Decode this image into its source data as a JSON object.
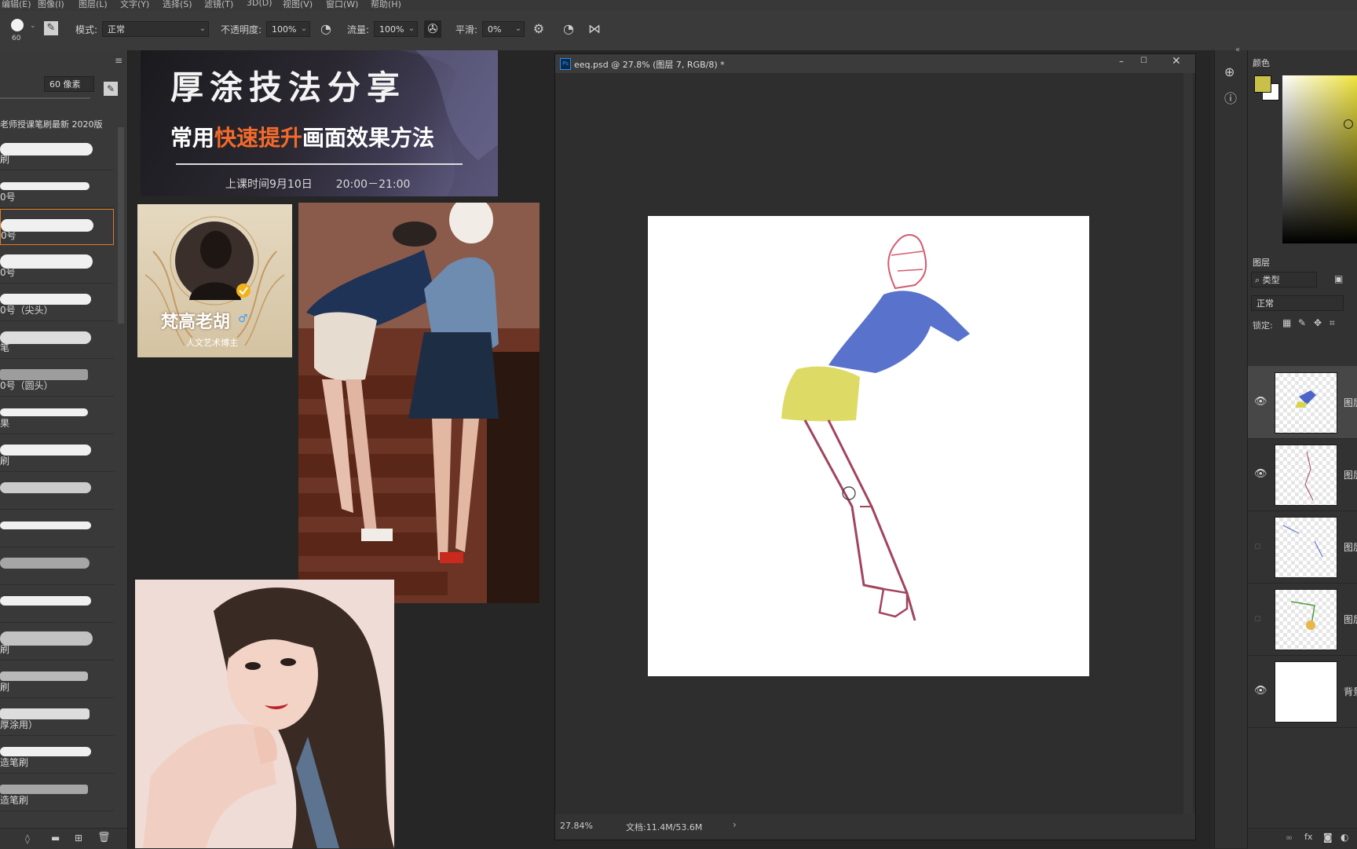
{
  "menubar": {
    "items": [
      "编辑(E)",
      "图像(I)",
      "图层(L)",
      "文字(Y)",
      "选择(S)",
      "滤镜(T)",
      "3D(D)",
      "视图(V)",
      "窗口(W)",
      "帮助(H)"
    ]
  },
  "options": {
    "brush_size": "60",
    "mode_label": "模式:",
    "mode_value": "正常",
    "opacity_label": "不透明度:",
    "opacity_value": "100%",
    "flow_label": "流量:",
    "flow_value": "100%",
    "smooth_label": "平滑:",
    "smooth_value": "0%"
  },
  "brush_panel": {
    "size_value": "60 像素",
    "group_title": "老师授课笔刷最新 2020版",
    "brushes": [
      {
        "name": "刷"
      },
      {
        "name": "0号"
      },
      {
        "name": "0号"
      },
      {
        "name": "0号"
      },
      {
        "name": "0号（尖头）"
      },
      {
        "name": "笔"
      },
      {
        "name": "0号（圆头）"
      },
      {
        "name": "果"
      },
      {
        "name": "刷"
      },
      {
        "name": ""
      },
      {
        "name": ""
      },
      {
        "name": ""
      },
      {
        "name": ""
      },
      {
        "name": "刷"
      },
      {
        "name": "刷"
      },
      {
        "name": "厚涂用）"
      },
      {
        "name": "造笔刷"
      },
      {
        "name": "造笔刷"
      }
    ]
  },
  "banner": {
    "title": "厚涂技法分享",
    "subtitle_pre": "常用",
    "subtitle_highlight": "快速提升",
    "subtitle_post": "画面效果方法",
    "time_label": "上课时间9月10日",
    "time_range": "20:00－21:00"
  },
  "profile": {
    "name": "梵高老胡",
    "role": "人文艺术博主"
  },
  "document": {
    "title": "eeq.psd @ 27.8% (图层 7, RGB/8) *",
    "zoom": "27.84%",
    "doc_size": "文档:11.4M/53.6M"
  },
  "color_panel": {
    "tab": "颜色",
    "foreground": "#c9c04a",
    "background": "#ffffff"
  },
  "layers_panel": {
    "tab": "图层",
    "filter_label": "类型",
    "blend_mode": "正常",
    "lock_label": "锁定:",
    "layers": [
      {
        "name": "图层",
        "visible": true
      },
      {
        "name": "图层",
        "visible": true
      },
      {
        "name": "图层",
        "visible": false
      },
      {
        "name": "图层",
        "visible": false
      },
      {
        "name": "背景",
        "visible": true
      }
    ]
  },
  "colors": {
    "accent": "#e07a1f",
    "highlight": "#f26a2b"
  }
}
